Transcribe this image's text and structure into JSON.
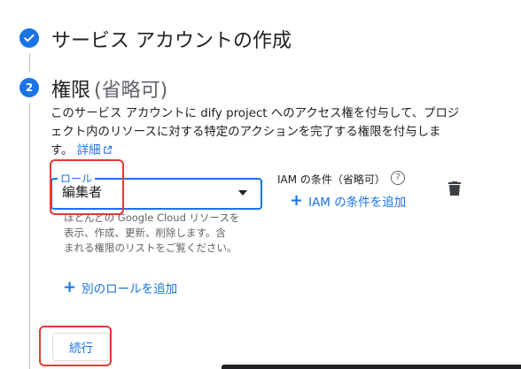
{
  "step1": {
    "title": "サービス アカウントの作成"
  },
  "step2": {
    "number": "2",
    "title": "権限",
    "title_suffix": "(省略可)",
    "description_line1": "このサービス アカウントに dify project へのアクセス権を付与して、プロジ",
    "description_line2": "ェクト内のリソースに対する特定のアクションを完了する権限を付与しま",
    "description_line3": "す。",
    "details_link": "詳細"
  },
  "role": {
    "label": "ロール",
    "value": "編集者",
    "hint_line1": "ほとんどの Google Cloud リソースを",
    "hint_line2": "表示、作成、更新、削除します。含",
    "hint_line3": "まれる権限のリストをご覧ください。"
  },
  "iam": {
    "label": "IAM の条件（省略可）",
    "help": "?",
    "add_condition": "IAM の条件を追加"
  },
  "add_role": "別のロールを追加",
  "continue": "続行"
}
